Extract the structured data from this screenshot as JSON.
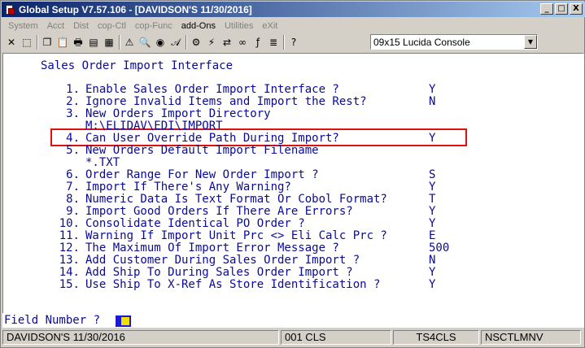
{
  "window": {
    "title": "Global Setup V7.57.106 - [DAVIDSON'S 11/30/2016]",
    "minimize": "_",
    "maximize": "□",
    "close": "X"
  },
  "menu": [
    {
      "label": "System",
      "active": false
    },
    {
      "label": "Acct",
      "active": false
    },
    {
      "label": "Dist",
      "active": false
    },
    {
      "label": "cop-Ctl",
      "active": false
    },
    {
      "label": "cop-Func",
      "active": false
    },
    {
      "label": "add-Ons",
      "active": true
    },
    {
      "label": "Utilities",
      "active": false
    },
    {
      "label": "eXit",
      "active": false
    }
  ],
  "toolbar": {
    "icons": [
      "close-icon",
      "select-icon",
      "copy-icon",
      "paste-icon",
      "print-icon",
      "notes-icon",
      "calendar-icon",
      "find-icon",
      "magnify-icon",
      "browser-icon",
      "font-icon",
      "tools-icon",
      "lightning-icon",
      "link-icon",
      "chain-icon",
      "function-icon",
      "stack-icon",
      "help-icon"
    ],
    "glyphs": [
      "✕",
      "⬚",
      "❐",
      "📋",
      "🖶",
      "▤",
      "▦",
      "⚠",
      "🔍",
      "◉",
      "𝒜",
      "⚙",
      "⚡",
      "⇄",
      "∞",
      "ƒ",
      "≣",
      "?"
    ],
    "font_value": "09x15 Lucida Console"
  },
  "terminal": {
    "header": "Sales Order Import Interface",
    "rows": [
      {
        "num": "1.",
        "label": "Enable Sales Order Import Interface ?",
        "value": "Y"
      },
      {
        "num": "2.",
        "label": "Ignore Invalid Items and Import the Rest?",
        "value": "N"
      },
      {
        "num": "3.",
        "label": "New Orders Import Directory",
        "value": ""
      },
      {
        "num": "",
        "label": "M:\\ELIDAV\\EDI\\IMPORT",
        "value": ""
      },
      {
        "num": "4.",
        "label": "Can User Override Path During Import?",
        "value": "Y"
      },
      {
        "num": "5.",
        "label": "New Orders Default Import Filename",
        "value": ""
      },
      {
        "num": "",
        "label": "*.TXT",
        "value": ""
      },
      {
        "num": "6.",
        "label": "Order Range For New Order Import ?",
        "value": "S"
      },
      {
        "num": "7.",
        "label": "Import If There's Any Warning?",
        "value": "Y"
      },
      {
        "num": "8.",
        "label": "Numeric Data Is Text Format Or Cobol Format?",
        "value": "T"
      },
      {
        "num": "9.",
        "label": "Import Good Orders If There Are Errors?",
        "value": "Y"
      },
      {
        "num": "10.",
        "label": "Consolidate Identical PO Order ?",
        "value": "Y"
      },
      {
        "num": "11.",
        "label": "Warning If Import Unit Prc <> Eli Calc Prc ?",
        "value": "E"
      },
      {
        "num": "12.",
        "label": "The Maximum Of Import Error Message ?",
        "value": "500"
      },
      {
        "num": "13.",
        "label": "Add Customer During Sales Order Import ?",
        "value": "N"
      },
      {
        "num": "14.",
        "label": "Add Ship To During Sales Order Import ?",
        "value": "Y"
      },
      {
        "num": "15.",
        "label": "Use Ship To X-Ref As Store Identification ?",
        "value": "Y"
      }
    ],
    "prompt": "Field Number ?"
  },
  "status": {
    "company": "DAVIDSON'S 11/30/2016",
    "code": "001 CLS",
    "terminal": "TS4CLS",
    "program": "NSCTLMNV"
  }
}
